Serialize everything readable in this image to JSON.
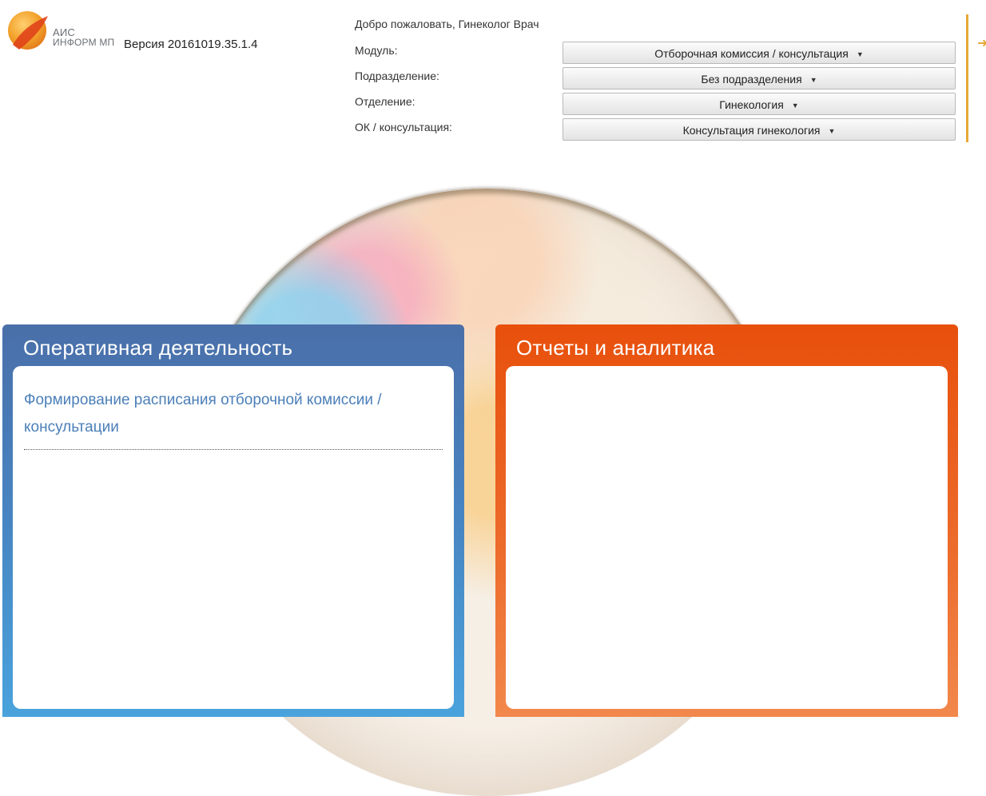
{
  "header": {
    "logo_line1": "АИС",
    "logo_line2": "ИНФОРМ МП",
    "version": "Версия 20161019.35.1.4",
    "welcome": "Добро пожаловать, Гинеколог Врач",
    "fields": {
      "module": {
        "label": "Модуль:",
        "value": "Отборочная комиссия / консультация"
      },
      "subdivision": {
        "label": "Подразделение:",
        "value": "Без подразделения"
      },
      "department": {
        "label": "Отделение:",
        "value": "Гинекология"
      },
      "consultation": {
        "label": "ОК / консультация:",
        "value": "Консультация гинекология"
      }
    }
  },
  "panels": {
    "operations": {
      "title": "Оперативная деятельность",
      "link": "Формирование расписания отборочной комиссии / консультации"
    },
    "reports": {
      "title": "Отчеты и аналитика"
    }
  },
  "colors": {
    "accent_orange": "#e8500c",
    "panel_blue": "#4a6fa9",
    "link_blue": "#4b7fb8"
  },
  "icons": {
    "caret": "caret-down-icon",
    "logo": "ais-logo-icon",
    "logout": "logout-arrow-icon"
  }
}
